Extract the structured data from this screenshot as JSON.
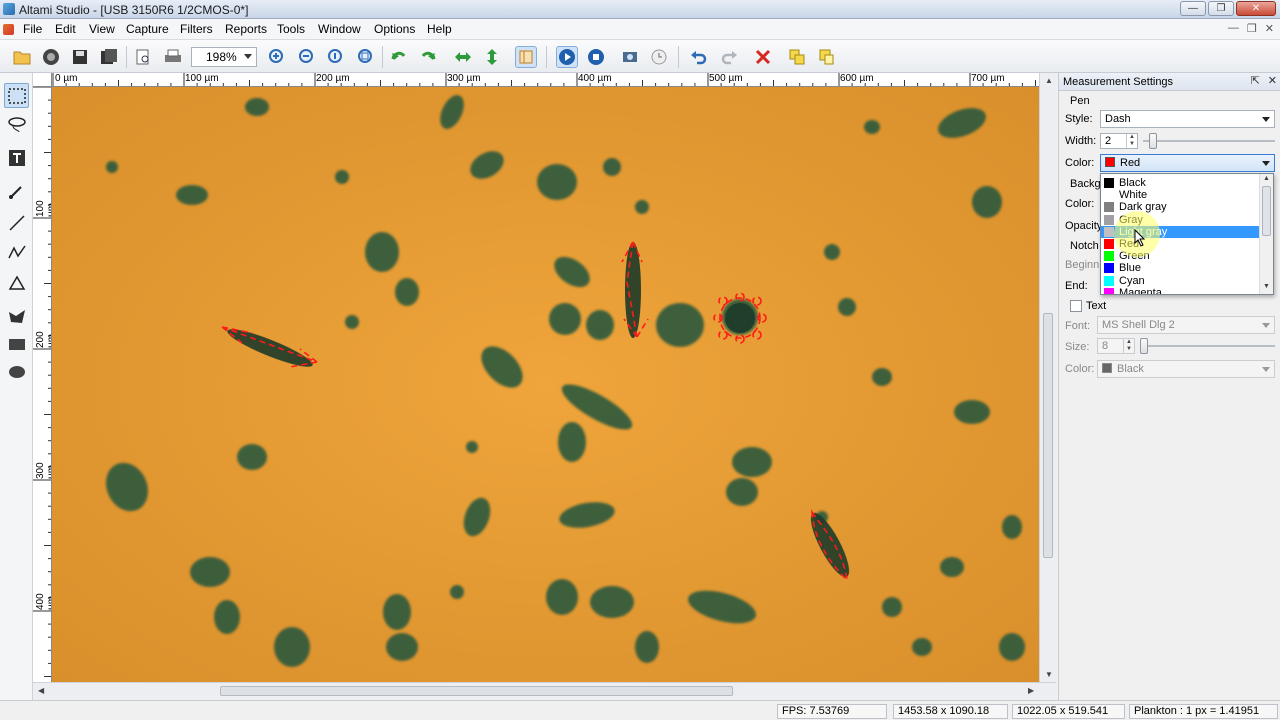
{
  "window": {
    "title": "Altami Studio - [USB 3150R6 1/2CMOS-0*]",
    "min": "—",
    "max": "❐",
    "close": "✕"
  },
  "menu": {
    "items": [
      "File",
      "Edit",
      "View",
      "Capture",
      "Filters",
      "Reports",
      "Tools",
      "Window",
      "Options",
      "Help"
    ],
    "mdi": [
      "—",
      "❐",
      "✕"
    ]
  },
  "toolbar": {
    "zoom": "198%"
  },
  "ruler": {
    "top": [
      "0 µm",
      "100 µm",
      "200 µm",
      "300 µm",
      "400 µm",
      "500 µm",
      "600 µm",
      "700 µm"
    ],
    "left": [
      "100 µm",
      "200 µm",
      "300 µm",
      "400 µm"
    ]
  },
  "panel": {
    "title": "Measurement Settings",
    "pin": "⇱",
    "close": "✕",
    "pen_group": "Pen",
    "style_label": "Style:",
    "style_value": "Dash",
    "width_label": "Width:",
    "width_value": "2",
    "color_label": "Color:",
    "color_value": "Red",
    "background_label": "Backgr",
    "bg_color_label": "Color:",
    "opacity_label": "Opacity",
    "notch_label": "Notch",
    "beginning_label": "Beginni",
    "end_label": "End:",
    "text_checkbox_label": "Text",
    "font_label": "Font:",
    "font_value": "MS Shell Dlg 2",
    "size_label": "Size:",
    "size_value": "8",
    "text_color_label": "Color:",
    "text_color_value": "Black"
  },
  "color_options": [
    {
      "name": "Black",
      "color": "#000000"
    },
    {
      "name": "White",
      "color": "#ffffff"
    },
    {
      "name": "Dark gray",
      "color": "#808080"
    },
    {
      "name": "Gray",
      "color": "#a0a0a4"
    },
    {
      "name": "Light gray",
      "color": "#c0c0c0"
    },
    {
      "name": "Red",
      "color": "#ff0000"
    },
    {
      "name": "Green",
      "color": "#00ff00"
    },
    {
      "name": "Blue",
      "color": "#0000ff"
    },
    {
      "name": "Cyan",
      "color": "#00ffff"
    },
    {
      "name": "Magenta",
      "color": "#ff00ff"
    }
  ],
  "color_selected_index": 4,
  "status": {
    "fps": "FPS: 7.53769",
    "size": "1453.58 x 1090.18 µm",
    "position": "1022.05 x 519.541 µm",
    "calibration": "Plankton : 1 px = 1.41951 µm"
  },
  "accent_color": "#3399ff",
  "annotation_color": "#ff0000"
}
